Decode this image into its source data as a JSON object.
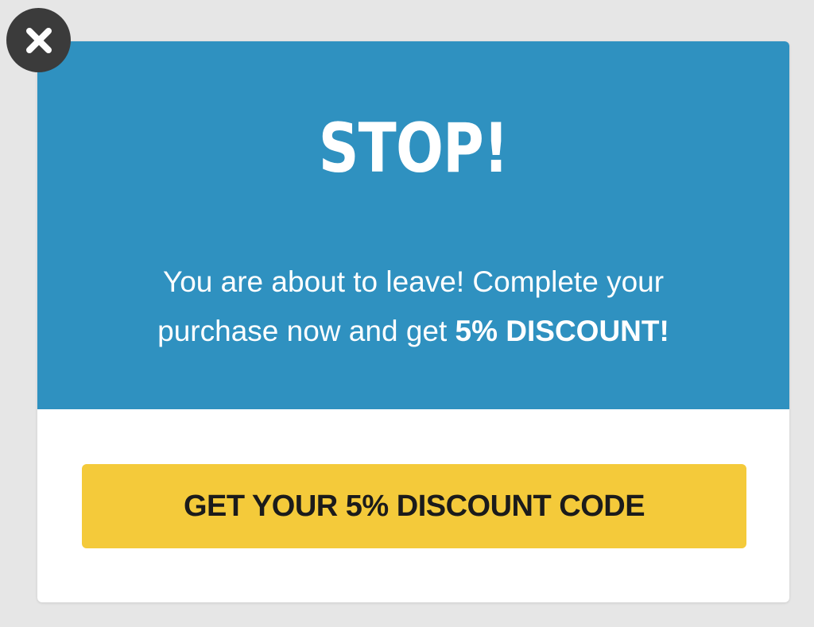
{
  "popup": {
    "headline": "STOP!",
    "message_line1": "You are about to leave! Complete your",
    "message_line2_prefix": "purchase now and get ",
    "message_line2_emphasis": "5% DISCOUNT!",
    "cta_label": "GET YOUR 5% DISCOUNT CODE"
  },
  "close_button": {
    "icon": "close-icon"
  },
  "colors": {
    "page_background": "#e6e6e6",
    "header_background": "#2f91c0",
    "cta_background": "#f4ca3a",
    "close_background": "#3b3b3b",
    "text_light": "#ffffff",
    "text_dark": "#1b1b1b"
  }
}
